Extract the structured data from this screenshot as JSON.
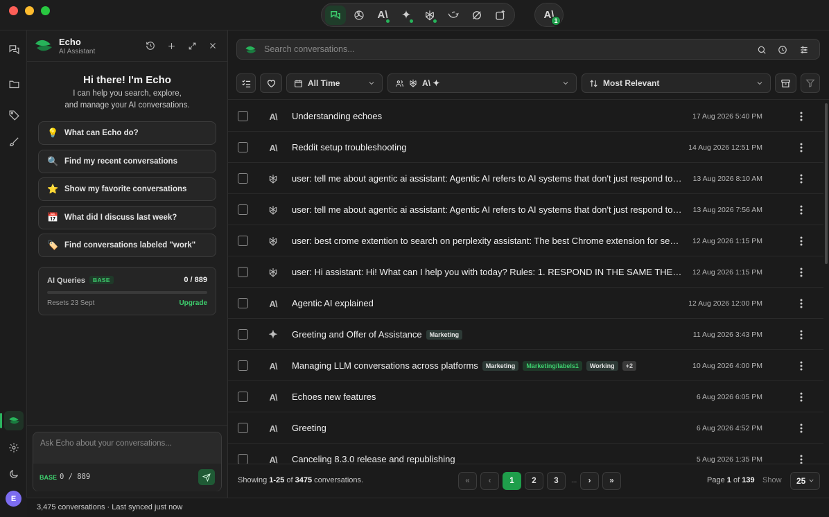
{
  "platforms": [
    {
      "name": "echo-chats",
      "active": true
    },
    {
      "name": "chatgpt"
    },
    {
      "name": "claude",
      "dot": true
    },
    {
      "name": "gemini",
      "dot": true
    },
    {
      "name": "perplexity",
      "dot": true
    },
    {
      "name": "deepseek"
    },
    {
      "name": "grok"
    },
    {
      "name": "new-platform"
    }
  ],
  "profile": {
    "badge": "1",
    "glyph": "A\\"
  },
  "rail": {
    "avatar_letter": "E"
  },
  "echo": {
    "name": "Echo",
    "subtitle": "AI Assistant",
    "greeting": "Hi there! I'm Echo",
    "description_line1": "I can help you search, explore,",
    "description_line2": "and manage your AI conversations.",
    "suggestions": [
      {
        "emoji": "💡",
        "label": "What can Echo do?"
      },
      {
        "emoji": "🔍",
        "label": "Find my recent conversations"
      },
      {
        "emoji": "⭐",
        "label": "Show my favorite conversations"
      },
      {
        "emoji": "📅",
        "label": "What did I discuss last week?"
      },
      {
        "emoji": "🏷️",
        "label": "Find conversations labeled \"work\""
      }
    ],
    "quota": {
      "label": "AI Queries",
      "plan": "BASE",
      "used": 0,
      "limit": 889,
      "count_text": "0 / 889",
      "reset_text": "Resets 23 Sept",
      "upgrade_label": "Upgrade"
    },
    "input": {
      "placeholder": "Ask Echo about your conversations...",
      "plan": "BASE",
      "count_text": "0 / 889"
    }
  },
  "search": {
    "placeholder": "Search conversations..."
  },
  "filters": {
    "time_label": "All Time",
    "platform_glyphs": "A\\ ✦",
    "sort_label": "Most Relevant"
  },
  "conversations": [
    {
      "platform": "claude",
      "title": "Understanding echoes",
      "date": "17 Aug 2026 5:40 PM",
      "tags": []
    },
    {
      "platform": "claude",
      "title": "Reddit setup troubleshooting",
      "date": "14 Aug 2026 12:51 PM",
      "tags": []
    },
    {
      "platform": "perplexity",
      "title": "user: tell me about agentic ai assistant: Agentic AI refers to AI systems that don't just respond to queries",
      "date": "13 Aug 2026 8:10 AM",
      "tags": []
    },
    {
      "platform": "perplexity",
      "title": "user: tell me about agentic ai assistant: Agentic AI refers to AI systems that don't just respond to queries",
      "date": "13 Aug 2026 7:56 AM",
      "tags": []
    },
    {
      "platform": "perplexity",
      "title": "user: best crome extention to search on perplexity assistant: The best Chrome extension for searching",
      "date": "12 Aug 2026 1:15 PM",
      "tags": []
    },
    {
      "platform": "perplexity",
      "title": "user: Hi assistant: Hi! What can I help you with today? Rules: 1. RESPOND IN THE SAME THE LANGUAGE",
      "date": "12 Aug 2026 1:15 PM",
      "tags": []
    },
    {
      "platform": "claude",
      "title": "Agentic AI explained",
      "date": "12 Aug 2026 12:00 PM",
      "tags": []
    },
    {
      "platform": "gemini",
      "title": "Greeting and Offer of Assistance",
      "date": "11 Aug 2026 3:43 PM",
      "tags": [
        {
          "text": "Marketing",
          "style": "dark"
        }
      ]
    },
    {
      "platform": "claude",
      "title": "Managing LLM conversations across platforms",
      "date": "10 Aug 2026 4:00 PM",
      "tags": [
        {
          "text": "Marketing",
          "style": "dark"
        },
        {
          "text": "Marketing/labels1",
          "style": "green"
        },
        {
          "text": "Working",
          "style": "dark"
        },
        {
          "text": "+2",
          "style": "more"
        }
      ]
    },
    {
      "platform": "claude",
      "title": "Echoes new features",
      "date": "6 Aug 2026 6:05 PM",
      "tags": []
    },
    {
      "platform": "claude",
      "title": "Greeting",
      "date": "6 Aug 2026 4:52 PM",
      "tags": []
    },
    {
      "platform": "claude",
      "title": "Canceling 8.3.0 release and republishing",
      "date": "5 Aug 2026 1:35 PM",
      "tags": []
    }
  ],
  "pagination": {
    "showing_range": "1-25",
    "total": "3475",
    "suffix": "conversations.",
    "pages": [
      "1",
      "2",
      "3"
    ],
    "current_page": "1",
    "total_pages": "139",
    "page_size": "25",
    "page_label": "Page",
    "of_label": "of",
    "show_label": "Show",
    "showing_label": "Showing",
    "ellipsis": "..."
  },
  "status": {
    "text": "3,475 conversations · Last synced just now"
  },
  "colors": {
    "accent": "#1f9e4b",
    "accent_text": "#3ecf6e",
    "background": "#1b1b1b"
  }
}
